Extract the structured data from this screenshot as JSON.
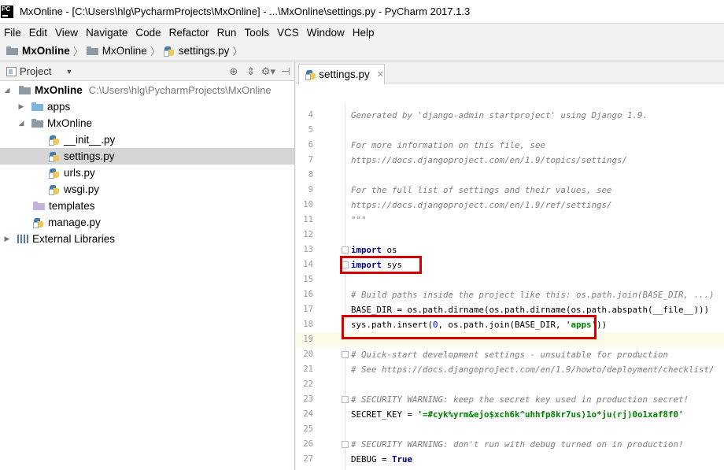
{
  "window": {
    "title": "MxOnline - [C:\\Users\\hlg\\PycharmProjects\\MxOnline] - ...\\MxOnline\\settings.py - PyCharm 2017.1.3",
    "logo_text": "PC"
  },
  "menu": [
    "File",
    "Edit",
    "View",
    "Navigate",
    "Code",
    "Refactor",
    "Run",
    "Tools",
    "VCS",
    "Window",
    "Help"
  ],
  "breadcrumb": [
    "MxOnline",
    "MxOnline",
    "settings.py"
  ],
  "project_panel": {
    "title": "Project",
    "tree": [
      {
        "label": "MxOnline",
        "hint": "C:\\Users\\hlg\\PycharmProjects\\MxOnline"
      },
      {
        "label": "apps"
      },
      {
        "label": "MxOnline"
      },
      {
        "label": "__init__.py"
      },
      {
        "label": "settings.py",
        "selected": true
      },
      {
        "label": "urls.py"
      },
      {
        "label": "wsgi.py"
      },
      {
        "label": "templates"
      },
      {
        "label": "manage.py"
      },
      {
        "label": "External Libraries"
      }
    ]
  },
  "editor": {
    "tab_label": "settings.py",
    "current_line": 19,
    "lines": [
      {
        "n": "4",
        "text": "Generated by 'django-admin startproject' using Django 1.9."
      },
      {
        "n": "5",
        "text": ""
      },
      {
        "n": "6",
        "text": "For more information on this file, see"
      },
      {
        "n": "7",
        "text": "https://docs.djangoproject.com/en/1.9/topics/settings/"
      },
      {
        "n": "8",
        "text": ""
      },
      {
        "n": "9",
        "text": "For the full list of settings and their values, see"
      },
      {
        "n": "10",
        "text": "https://docs.djangoproject.com/en/1.9/ref/settings/"
      },
      {
        "n": "11",
        "text": "\"\"\""
      },
      {
        "n": "12",
        "text": ""
      },
      {
        "n": "13",
        "kw": "import",
        "rest": " os"
      },
      {
        "n": "14",
        "kw": "import",
        "rest": " sys"
      },
      {
        "n": "15",
        "text": ""
      },
      {
        "n": "16",
        "text": "# Build paths inside the project like this: os.path.join(BASE_DIR, ...)"
      },
      {
        "n": "17",
        "text": "BASE_DIR = os.path.dirname(os.path.dirname(os.path.abspath(__file__)))"
      },
      {
        "n": "18",
        "pre": "sys.path.insert(",
        "num": "0",
        "mid": ", os.path.join(BASE_DIR, ",
        "str": "'apps'",
        "post": "))"
      },
      {
        "n": "19",
        "text": ""
      },
      {
        "n": "20",
        "text": "# Quick-start development settings - unsuitable for production"
      },
      {
        "n": "21",
        "text": "# See https://docs.djangoproject.com/en/1.9/howto/deployment/checklist/"
      },
      {
        "n": "22",
        "text": ""
      },
      {
        "n": "23",
        "text": "# SECURITY WARNING: keep the secret key used in production secret!"
      },
      {
        "n": "24",
        "pre": "SECRET_KEY = ",
        "str": "'=#cyk%yrm&ejo$xch6k^uhhfp8kr7us)1o*ju(rj)0o1xaf8f0'"
      },
      {
        "n": "25",
        "text": ""
      },
      {
        "n": "26",
        "text": "# SECURITY WARNING: don't run with debug turned on in production!"
      },
      {
        "n": "27",
        "pre": "DEBUG = ",
        "kw": "True"
      }
    ]
  },
  "colors": {
    "highlight_box": "#d40000",
    "current_line": "#fcfae8",
    "keyword": "#000080",
    "string": "#008000",
    "comment": "#7f7f7f"
  }
}
